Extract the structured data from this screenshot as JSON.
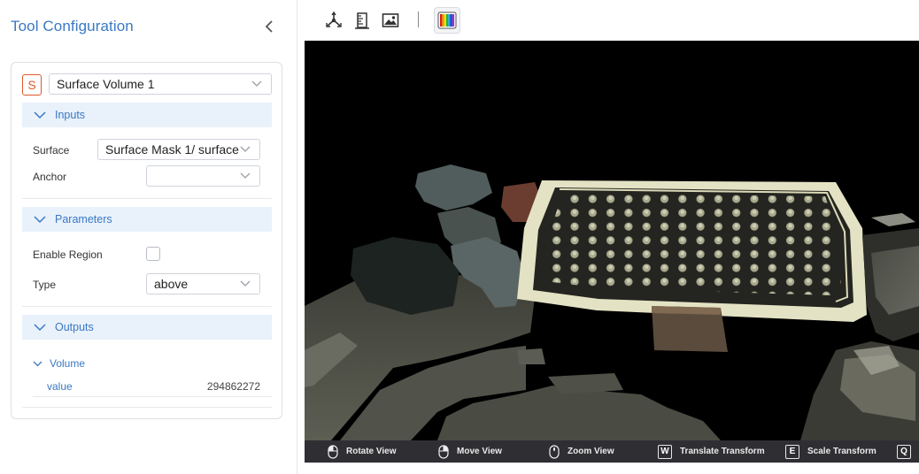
{
  "panel": {
    "title": "Tool Configuration",
    "tool_badge": "S",
    "tool_name": "Surface Volume 1"
  },
  "inputs": {
    "heading": "Inputs",
    "surface_label": "Surface",
    "surface_value": "Surface Mask 1/ surface",
    "anchor_label": "Anchor",
    "anchor_value": ""
  },
  "parameters": {
    "heading": "Parameters",
    "enable_region_label": "Enable Region",
    "enable_region_checked": false,
    "type_label": "Type",
    "type_value": "above"
  },
  "outputs": {
    "heading": "Outputs",
    "group": "Volume",
    "key": "value",
    "value": "294862272"
  },
  "toolbar": {
    "icons": [
      "axes-icon",
      "ruler-icon",
      "image-icon",
      "color-map-icon"
    ]
  },
  "status_hints": [
    {
      "key": "mouse-left",
      "label": "Rotate View"
    },
    {
      "key": "mouse-right",
      "label": "Move View"
    },
    {
      "key": "mouse-wheel",
      "label": "Zoom View"
    },
    {
      "key": "W",
      "label": "Translate Transform"
    },
    {
      "key": "E",
      "label": "Scale Transform"
    },
    {
      "key": "Q",
      "label": ""
    }
  ],
  "colors": {
    "accent": "#3a78c3",
    "badge": "#e0582a",
    "section_bg": "#e9f1fb",
    "viewer_bg": "#000000",
    "statusbar_bg": "#2f2f33"
  }
}
